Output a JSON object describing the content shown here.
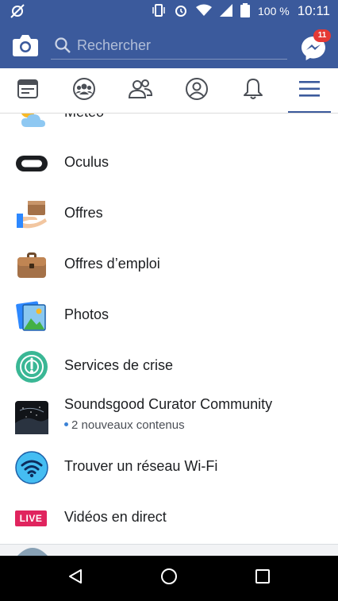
{
  "status_bar": {
    "battery_percent": "100 %",
    "time": "10:11",
    "icons": [
      "sync-off-icon",
      "vibrate-icon",
      "alarm-icon",
      "wifi-icon",
      "signal-icon",
      "battery-icon"
    ]
  },
  "header": {
    "search_placeholder": "Rechercher",
    "messenger_badge": "11",
    "brand_color": "#3b5a9c",
    "badge_color": "#e53935"
  },
  "tabs": [
    {
      "name": "news-feed",
      "icon": "news-feed-icon",
      "active": false
    },
    {
      "name": "groups",
      "icon": "groups-icon",
      "active": false
    },
    {
      "name": "friends",
      "icon": "friends-icon",
      "active": false
    },
    {
      "name": "profile",
      "icon": "profile-icon",
      "active": false
    },
    {
      "name": "notifications",
      "icon": "bell-icon",
      "active": false
    },
    {
      "name": "menu",
      "icon": "menu-icon",
      "active": true
    }
  ],
  "menu": {
    "items": [
      {
        "label": "Météo",
        "icon": "weather-icon"
      },
      {
        "label": "Oculus",
        "icon": "oculus-icon"
      },
      {
        "label": "Offres",
        "icon": "offers-icon"
      },
      {
        "label": "Offres d’emploi",
        "icon": "jobs-briefcase-icon"
      },
      {
        "label": "Photos",
        "icon": "photos-icon"
      },
      {
        "label": "Services de crise",
        "icon": "crisis-response-icon"
      },
      {
        "label": "Soundsgood Curator Community",
        "sub": "2 nouveaux contenus",
        "icon": "group-thumbnail-icon"
      },
      {
        "label": "Trouver un réseau Wi-Fi",
        "icon": "find-wifi-icon"
      },
      {
        "label": "Vidéos en direct",
        "icon": "live-video-icon",
        "live_badge": "LIVE"
      }
    ]
  },
  "system_nav": {
    "icons": [
      "back-icon",
      "home-icon",
      "recents-icon"
    ]
  }
}
